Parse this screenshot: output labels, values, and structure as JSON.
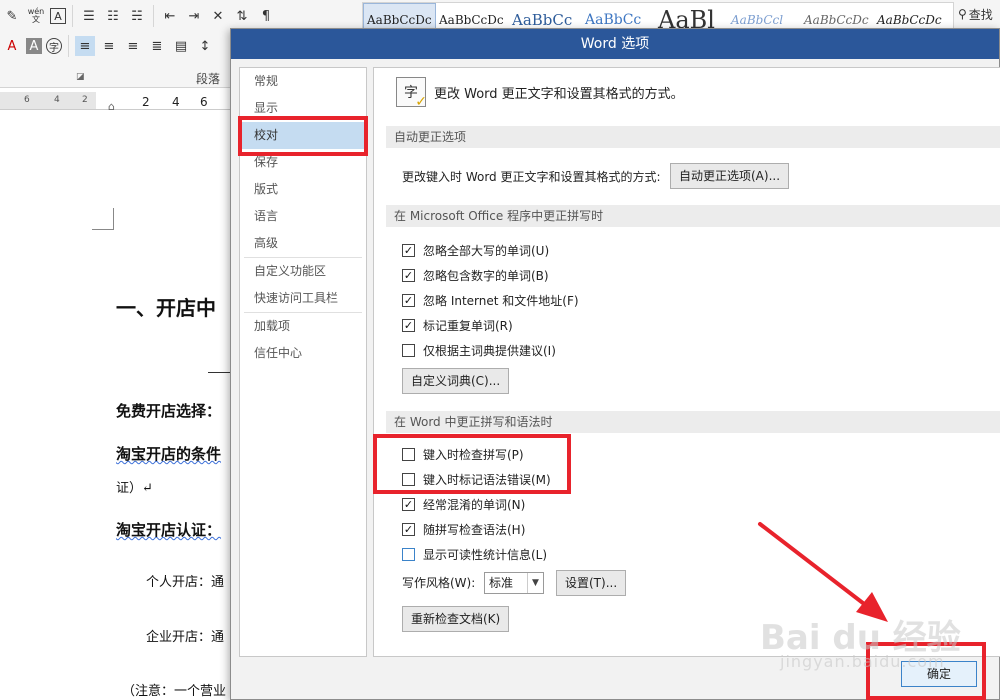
{
  "ribbon": {
    "font_icons": [
      "eraser-icon",
      "phonetic-icon",
      "char-border-icon"
    ],
    "phonetic_label": "wén\n文",
    "para_group_label": "段落",
    "find_label": "查找",
    "styles": [
      "AaBbCcDc",
      "AaBbCcDc",
      "AaBbCc",
      "AaBbCc",
      "AaBl",
      "AaBbCcl",
      "AaBbCcDc",
      "AaBbCcDc"
    ],
    "ruler_numbers": [
      "6",
      "4",
      "2",
      "2",
      "4",
      "6"
    ]
  },
  "document": {
    "heading": "一、开店中",
    "lines": [
      "免费开店选择：",
      "淘宝开店的条件",
      "证）↵",
      "淘宝开店认证：",
      "个人开店：通",
      "企业开店：通",
      "（注意：一个营业"
    ]
  },
  "dialog": {
    "title": "Word 选项",
    "nav": [
      "常规",
      "显示",
      "校对",
      "保存",
      "版式",
      "语言",
      "高级",
      "自定义功能区",
      "快速访问工具栏",
      "加载项",
      "信任中心"
    ],
    "intro": "更改 Word 更正文字和设置其格式的方式。",
    "autocorrect": {
      "header": "自动更正选项",
      "label": "更改键入时 Word 更正文字和设置其格式的方式:",
      "button": "自动更正选项(A)..."
    },
    "office": {
      "header": "在 Microsoft Office 程序中更正拼写时",
      "options": [
        {
          "label": "忽略全部大写的单词(U)",
          "checked": true
        },
        {
          "label": "忽略包含数字的单词(B)",
          "checked": true
        },
        {
          "label": "忽略 Internet 和文件地址(F)",
          "checked": true
        },
        {
          "label": "标记重复单词(R)",
          "checked": true
        },
        {
          "label": "仅根据主词典提供建议(I)",
          "checked": false
        }
      ],
      "dict_button": "自定义词典(C)..."
    },
    "word": {
      "header": "在 Word 中更正拼写和语法时",
      "options": [
        {
          "label": "键入时检查拼写(P)",
          "checked": false
        },
        {
          "label": "键入时标记语法错误(M)",
          "checked": false
        },
        {
          "label": "经常混淆的单词(N)",
          "checked": true
        },
        {
          "label": "随拼写检查语法(H)",
          "checked": true
        },
        {
          "label": "显示可读性统计信息(L)",
          "checked": false
        }
      ],
      "writing_style_label": "写作风格(W):",
      "writing_style_value": "标准",
      "settings_button": "设置(T)...",
      "recheck_button": "重新检查文档(K)"
    },
    "ok_button": "确定"
  },
  "watermark": {
    "main": "Bai du 经验",
    "sub": "jingyan.baidu.com"
  },
  "colors": {
    "titlebar": "#2b579a",
    "highlight": "#e8232c",
    "nav_selected": "#c5dcf1"
  }
}
